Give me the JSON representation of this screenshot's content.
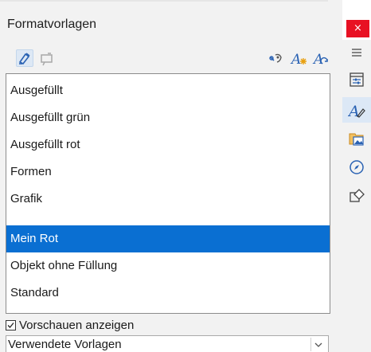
{
  "panel": {
    "title": "Formatvorlagen",
    "close_glyph": "×"
  },
  "toolbar": {
    "left_icons": [
      "fill-format-mode-icon",
      "update-style-icon"
    ],
    "right_icons": [
      "new-style-from-selection-icon",
      "new-style-icon",
      "edit-style-icon"
    ]
  },
  "styles_list": {
    "items": [
      "Ausgefüllt",
      "Ausgefüllt grün",
      "Ausgefüllt rot",
      "Formen",
      "Grafik",
      "Mein Rot",
      "Objekt ohne Füllung",
      "Standard"
    ],
    "selected": "Mein Rot"
  },
  "preview_toggle": {
    "label": "Vorschauen anzeigen",
    "checked": true
  },
  "filter": {
    "value": "Verwendete Vorlagen"
  },
  "sidebar": {
    "icons": [
      "menu-icon",
      "properties-icon",
      "styles-icon",
      "gallery-icon",
      "navigator-icon",
      "shapes-icon"
    ],
    "selected": "styles-icon"
  },
  "colors": {
    "accent": "#0a6fd2",
    "close": "#e81123"
  }
}
